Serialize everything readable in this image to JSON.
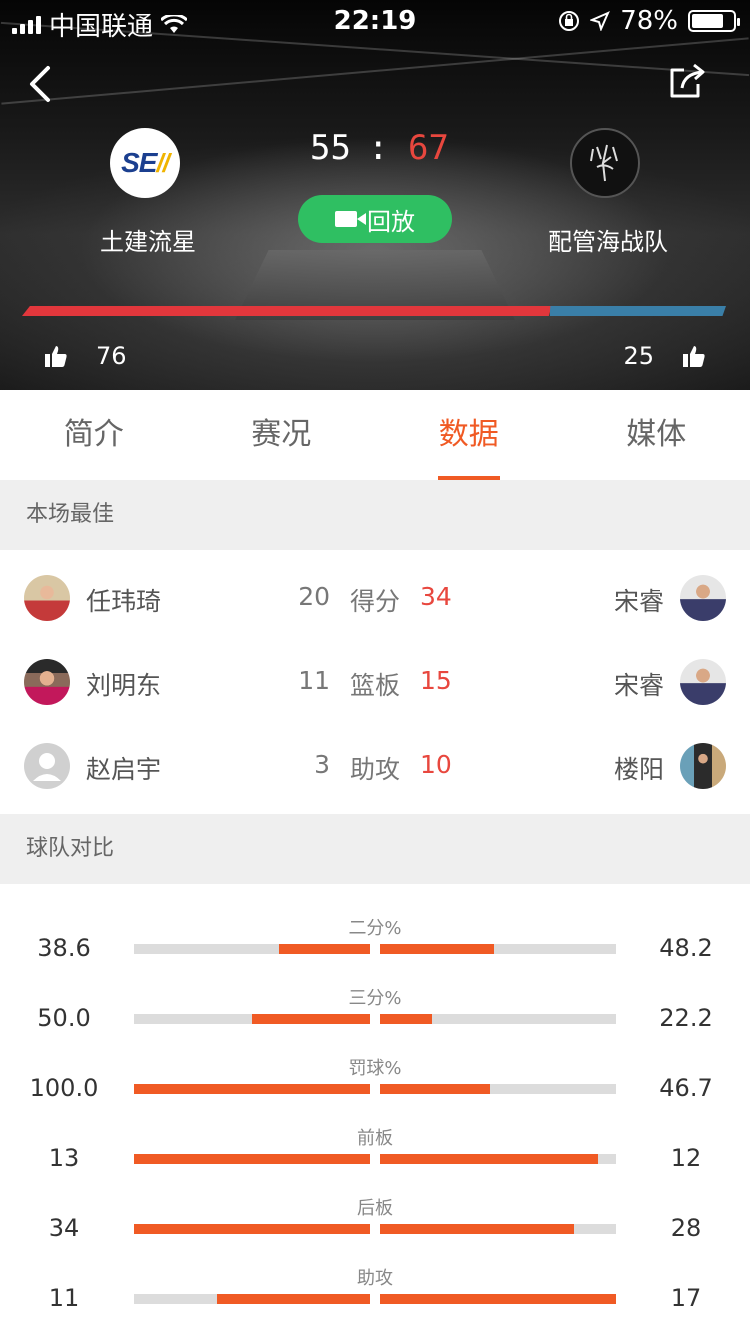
{
  "status_bar": {
    "carrier": "中国联通",
    "time": "22:19",
    "battery": "78%",
    "battery_level": 0.78
  },
  "match": {
    "home": {
      "name": "土建流星",
      "score": "55",
      "logo_text": "SE"
    },
    "away": {
      "name": "配管海战队",
      "score": "67"
    },
    "score_separator": ":",
    "replay_label": "回放",
    "home_likes": "76",
    "away_likes": "25",
    "home_like_share": 0.75
  },
  "tabs": [
    {
      "label": "简介"
    },
    {
      "label": "赛况"
    },
    {
      "label": "数据",
      "active": true
    },
    {
      "label": "媒体"
    }
  ],
  "best": {
    "title": "本场最佳",
    "rows": [
      {
        "left_name": "任玮琦",
        "left_value": "20",
        "label": "得分",
        "right_value": "34",
        "right_name": "宋睿"
      },
      {
        "left_name": "刘明东",
        "left_value": "11",
        "label": "篮板",
        "right_value": "15",
        "right_name": "宋睿"
      },
      {
        "left_name": "赵启宇",
        "left_value": "3",
        "label": "助攻",
        "right_value": "10",
        "right_name": "楼阳"
      }
    ]
  },
  "compare": {
    "title": "球队对比",
    "rows": [
      {
        "label": "二分%",
        "left": "38.6",
        "right": "48.2",
        "left_ratio": 0.386,
        "right_ratio": 0.482
      },
      {
        "label": "三分%",
        "left": "50.0",
        "right": "22.2",
        "left_ratio": 0.5,
        "right_ratio": 0.222
      },
      {
        "label": "罚球%",
        "left": "100.0",
        "right": "46.7",
        "left_ratio": 1.0,
        "right_ratio": 0.467
      },
      {
        "label": "前板",
        "left": "13",
        "right": "12",
        "left_ratio": 1.0,
        "right_ratio": 0.923
      },
      {
        "label": "后板",
        "left": "34",
        "right": "28",
        "left_ratio": 1.0,
        "right_ratio": 0.824
      },
      {
        "label": "助攻",
        "left": "11",
        "right": "17",
        "left_ratio": 0.647,
        "right_ratio": 1.0
      }
    ]
  },
  "colors": {
    "accent": "#f05a24",
    "away_score": "#e8473e",
    "replay": "#2fbf62",
    "home_bar": "#e2373c",
    "away_bar": "#3a7fa8"
  }
}
